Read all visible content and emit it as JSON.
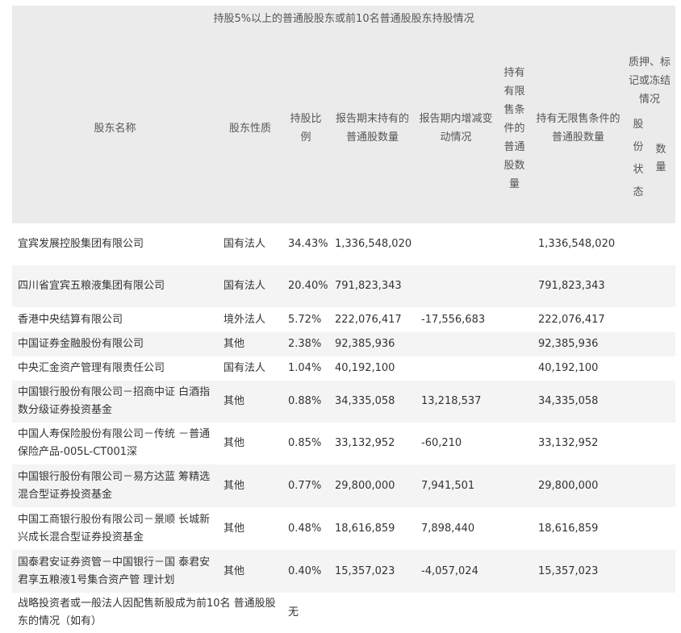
{
  "table": {
    "title": "持股5%以上的普通股股东或前10名普通股股东持股情况",
    "headers": {
      "name": "股东名称",
      "nature": "股东性质",
      "ratio": "持股比例",
      "period_end": "报告期末持有的普通股数量",
      "change": "报告期内增减变动情况",
      "restricted": "持有有限售条件的普通股数量",
      "unrestricted": "持有无限售条件的普通股数量",
      "pledge": "质押、标记或冻结情况",
      "pledge_status": "股份状态",
      "pledge_qty": "数量"
    },
    "rows": [
      {
        "name": "宜宾发展控股集团有限公司",
        "nature": "国有法人",
        "ratio": "34.43%",
        "period_end": "1,336,548,020",
        "change": "",
        "restricted": "",
        "unrestricted": "1,336,548,020",
        "status": "",
        "qty": ""
      },
      {
        "name": "四川省宜宾五粮液集团有限公司",
        "nature": "国有法人",
        "ratio": "20.40%",
        "period_end": "791,823,343",
        "change": "",
        "restricted": "",
        "unrestricted": "791,823,343",
        "status": "",
        "qty": ""
      },
      {
        "name": "香港中央结算有限公司",
        "nature": "境外法人",
        "ratio": "5.72%",
        "period_end": "222,076,417",
        "change": "-17,556,683",
        "restricted": "",
        "unrestricted": "222,076,417",
        "status": "",
        "qty": ""
      },
      {
        "name": "中国证券金融股份有限公司",
        "nature": "其他",
        "ratio": "2.38%",
        "period_end": "92,385,936",
        "change": "",
        "restricted": "",
        "unrestricted": "92,385,936",
        "status": "",
        "qty": ""
      },
      {
        "name": "中央汇金资产管理有限责任公司",
        "nature": "国有法人",
        "ratio": "1.04%",
        "period_end": "40,192,100",
        "change": "",
        "restricted": "",
        "unrestricted": "40,192,100",
        "status": "",
        "qty": ""
      },
      {
        "name": "中国银行股份有限公司－招商中证 白酒指数分级证券投资基金",
        "nature": "其他",
        "ratio": "0.88%",
        "period_end": "34,335,058",
        "change": "13,218,537",
        "restricted": "",
        "unrestricted": "34,335,058",
        "status": "",
        "qty": ""
      },
      {
        "name": "中国人寿保险股份有限公司－传统 －普通保险产品-005L-CT001深",
        "nature": "其他",
        "ratio": "0.85%",
        "period_end": "33,132,952",
        "change": "-60,210",
        "restricted": "",
        "unrestricted": "33,132,952",
        "status": "",
        "qty": ""
      },
      {
        "name": "中国银行股份有限公司－易方达蓝 筹精选混合型证券投资基金",
        "nature": "其他",
        "ratio": "0.77%",
        "period_end": "29,800,000",
        "change": "7,941,501",
        "restricted": "",
        "unrestricted": "29,800,000",
        "status": "",
        "qty": ""
      },
      {
        "name": "中国工商银行股份有限公司－景顺 长城新兴成长混合型证券投资基金",
        "nature": "其他",
        "ratio": "0.48%",
        "period_end": "18,616,859",
        "change": "7,898,440",
        "restricted": "",
        "unrestricted": "18,616,859",
        "status": "",
        "qty": ""
      },
      {
        "name": "国泰君安证券资管－中国银行－国 泰君安君享五粮液1号集合资产管 理计划",
        "nature": "其他",
        "ratio": "0.40%",
        "period_end": "15,357,023",
        "change": "-4,057,024",
        "restricted": "",
        "unrestricted": "15,357,023",
        "status": "",
        "qty": ""
      }
    ],
    "footer": {
      "label": "战略投资者或一般法人因配售新股成为前10名 普通股股东的情况（如有）",
      "value": "无"
    }
  }
}
